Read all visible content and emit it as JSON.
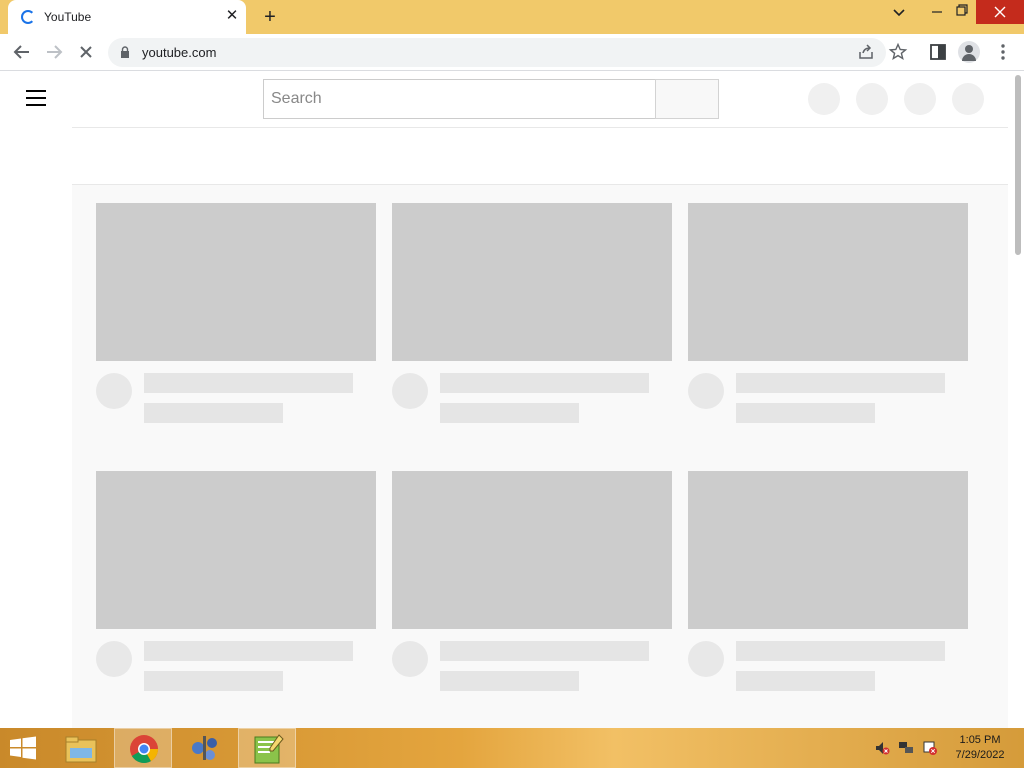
{
  "browser": {
    "tab_title": "YouTube",
    "tab_close": "✕",
    "new_tab": "+",
    "url": "youtube.com",
    "window_controls": {
      "dropdown": "⌄",
      "minimize": "—",
      "restore": "❐",
      "close": "✕"
    }
  },
  "toolbar": {
    "back": "←",
    "forward": "→",
    "stop": "✕",
    "share": "⇪",
    "bookmark": "☆",
    "side_panel": "▯",
    "menu": "⋮"
  },
  "youtube": {
    "search_placeholder": "Search",
    "search_value": ""
  },
  "colors": {
    "title_bar": "#f1c96a",
    "skeleton_thumb": "#cccccc",
    "skeleton_line": "#e5e5e5",
    "grid_background": "#f9f9f9"
  },
  "taskbar": {
    "apps": [
      "file-explorer-icon",
      "chrome-icon",
      "network-app-icon",
      "notepad-plus-icon"
    ],
    "clock_time": "1:05 PM",
    "clock_date": "7/29/2022"
  }
}
